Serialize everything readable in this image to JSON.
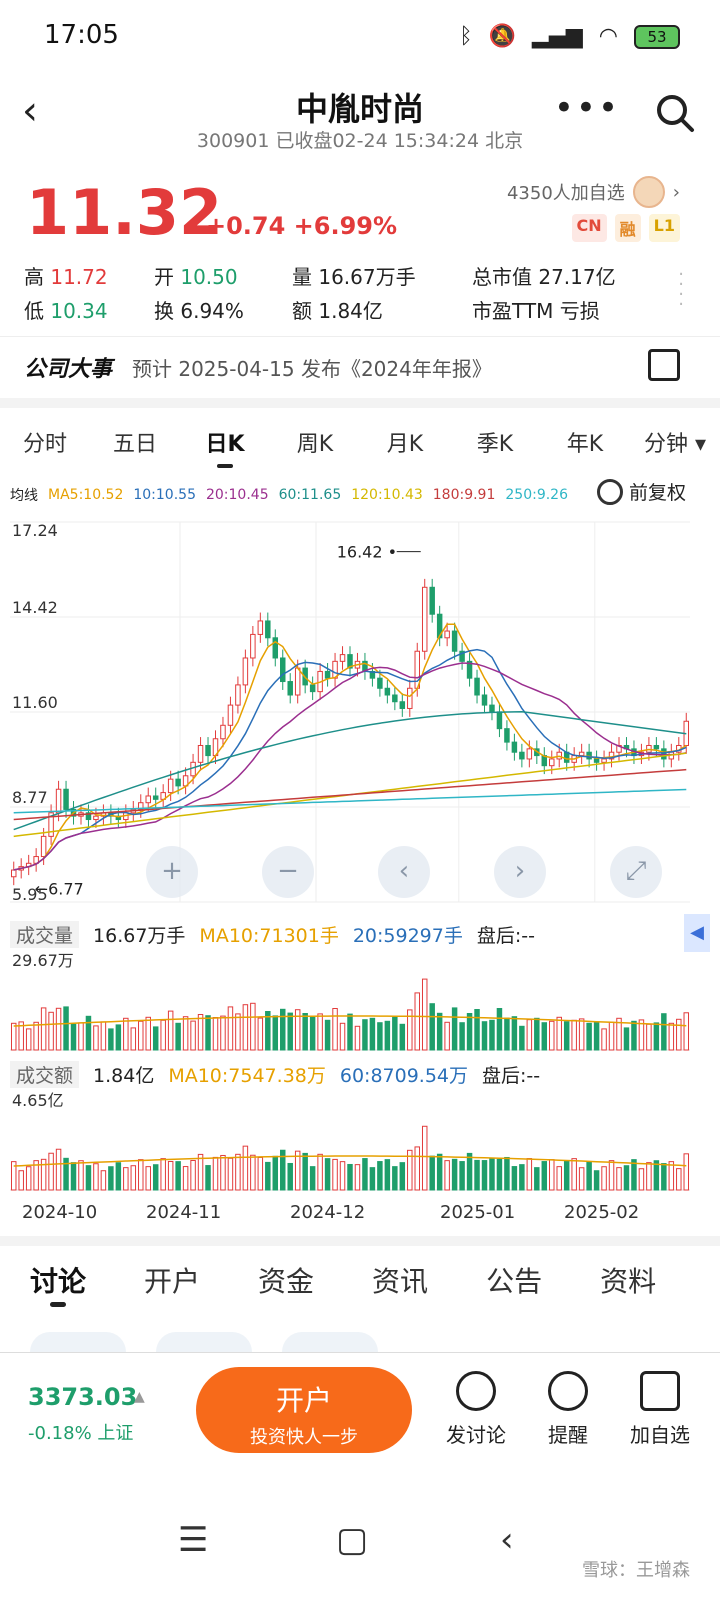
{
  "status": {
    "time": "17:05",
    "battery": "53"
  },
  "header": {
    "title": "中胤时尚",
    "subtitle": "300901 已收盘02-24 15:34:24 北京"
  },
  "quote": {
    "price": "11.32",
    "change": "+0.74 +6.99%",
    "followers": "4350人加自选",
    "tags": [
      "CN",
      "融",
      "L1"
    ],
    "stats": {
      "high_label": "高",
      "high": "11.72",
      "open_label": "开",
      "open": "10.50",
      "vol_label": "量",
      "vol": "16.67万手",
      "mcap_label": "总市值",
      "mcap": "27.17亿",
      "low_label": "低",
      "low": "10.34",
      "turn_label": "换",
      "turn": "6.94%",
      "amt_label": "额",
      "amt": "1.84亿",
      "pe_label": "市盈TTM",
      "pe": "亏损"
    }
  },
  "event": {
    "label": "公司大事",
    "text": "预计 2025-04-15 发布《2024年年报》"
  },
  "periods": [
    "分时",
    "五日",
    "日K",
    "周K",
    "月K",
    "季K",
    "年K",
    "分钟 ▾"
  ],
  "ma_legend": {
    "title": "均线",
    "items": [
      {
        "text": "MA5:10.52",
        "color": "#e6a000"
      },
      {
        "text": "10:10.55",
        "color": "#2a6fb8"
      },
      {
        "text": "20:10.45",
        "color": "#9b2f8f"
      },
      {
        "text": "60:11.65",
        "color": "#1e8f8a"
      },
      {
        "text": "120:10.43",
        "color": "#d4b800"
      },
      {
        "text": "180:9.91",
        "color": "#c43c3c"
      },
      {
        "text": "250:9.26",
        "color": "#2fb6c6"
      }
    ],
    "adjust": "前复权"
  },
  "chart_data": {
    "type": "candlestick",
    "y_ticks": [
      "17.24",
      "14.42",
      "11.60",
      "8.77",
      "5.95"
    ],
    "ylim": [
      5.95,
      17.24
    ],
    "high_marker": "16.42",
    "low_marker": "6.77",
    "x_labels": [
      "2024-10",
      "2024-11",
      "2024-12",
      "2025-01",
      "2025-02"
    ],
    "closes": [
      6.9,
      7.0,
      7.1,
      7.3,
      7.9,
      8.6,
      9.3,
      8.7,
      8.5,
      8.6,
      8.4,
      8.5,
      8.6,
      8.5,
      8.4,
      8.6,
      8.7,
      8.9,
      9.1,
      9.0,
      9.2,
      9.6,
      9.4,
      9.7,
      10.1,
      10.6,
      10.3,
      10.8,
      11.2,
      11.8,
      12.4,
      13.2,
      13.9,
      14.3,
      13.8,
      13.2,
      12.5,
      12.1,
      12.9,
      12.4,
      12.2,
      12.8,
      12.6,
      13.1,
      13.3,
      12.9,
      13.1,
      12.8,
      12.6,
      12.3,
      12.1,
      11.9,
      11.7,
      12.3,
      13.4,
      15.3,
      14.5,
      13.8,
      14.0,
      13.4,
      13.1,
      12.6,
      12.1,
      11.8,
      11.6,
      11.1,
      10.7,
      10.4,
      10.2,
      10.5,
      10.3,
      10.0,
      10.2,
      10.4,
      10.1,
      10.3,
      10.4,
      10.2,
      10.1,
      10.2,
      10.4,
      10.6,
      10.5,
      10.3,
      10.4,
      10.6,
      10.5,
      10.2,
      10.4,
      10.6,
      11.32
    ],
    "volume": {
      "label": "成交量",
      "value": "16.67万手",
      "ma10": "MA10:71301手",
      "ma20": "20:59297手",
      "after": "盘后:--",
      "max": "29.67万"
    },
    "amount": {
      "label": "成交额",
      "value": "1.84亿",
      "ma10": "MA10:7547.38万",
      "ma60": "60:8709.54万",
      "after": "盘后:--",
      "max": "4.65亿"
    }
  },
  "subtabs": [
    "讨论",
    "开户",
    "资金",
    "资讯",
    "公告",
    "资料"
  ],
  "bottom": {
    "index_value": "3373.03",
    "index_sub": "-0.18% 上证",
    "open_title": "开户",
    "open_sub": "投资快人一步",
    "actions": [
      "发讨论",
      "提醒",
      "加自选"
    ]
  },
  "watermark": "雪球：王增森"
}
